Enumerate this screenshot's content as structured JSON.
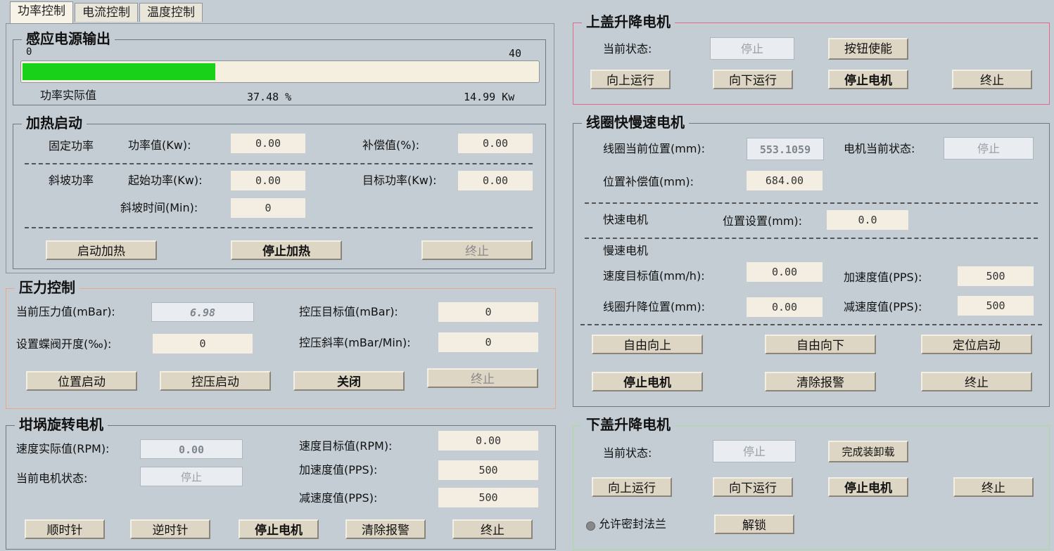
{
  "tabs": [
    "功率控制",
    "电流控制",
    "温度控制"
  ],
  "power_output": {
    "title": "感应电源输出",
    "scale_min": "0",
    "scale_max": "40",
    "progress_fraction": 0.3748,
    "actual_label": "功率实际值",
    "percent_text": "37.48 %",
    "kw_text": "14.99 Kw"
  },
  "heating": {
    "title": "加热启动",
    "fixed_power": "固定功率",
    "power_value_label": "功率值(Kw):",
    "power_value": "0.00",
    "compensation_label": "补偿值(%):",
    "compensation_value": "0.00",
    "ramp_power": "斜坡功率",
    "start_power_label": "起始功率(Kw):",
    "start_power_value": "0.00",
    "target_power_label": "目标功率(Kw):",
    "target_power_value": "0.00",
    "ramp_time_label": "斜坡时间(Min):",
    "ramp_time_value": "0",
    "start_btn": "启动加热",
    "stop_btn": "停止加热",
    "abort_btn": "终止"
  },
  "pressure": {
    "title": "压力控制",
    "current_label": "当前压力值(mBar):",
    "current_value": "6.98",
    "target_label": "控压目标值(mBar):",
    "target_value": "0",
    "valve_label": "设置蝶阀开度(‰):",
    "valve_value": "0",
    "slope_label": "控压斜率(mBar/Min):",
    "slope_value": "0",
    "pos_start_btn": "位置启动",
    "pressure_start_btn": "控压启动",
    "close_btn": "关闭",
    "abort_btn": "终止"
  },
  "crucible": {
    "title": "坩埚旋转电机",
    "speed_actual_label": "速度实际值(RPM):",
    "speed_actual_value": "0.00",
    "status_label": "当前电机状态:",
    "status_value": "停止",
    "speed_target_label": "速度目标值(RPM):",
    "speed_target_value": "0.00",
    "accel_label": "加速度值(PPS):",
    "accel_value": "500",
    "decel_label": "减速度值(PPS):",
    "decel_value": "500",
    "cw_btn": "顺时针",
    "ccw_btn": "逆时针",
    "stop_btn": "停止电机",
    "clear_btn": "清除报警",
    "abort_btn": "终止"
  },
  "upper_lid": {
    "title": "上盖升降电机",
    "status_label": "当前状态:",
    "status_value": "停止",
    "enable_btn": "按钮使能",
    "up_btn": "向上运行",
    "down_btn": "向下运行",
    "stop_btn": "停止电机",
    "abort_btn": "终止"
  },
  "coil": {
    "title": "线圈快慢速电机",
    "pos_label": "线圈当前位置(mm):",
    "pos_value": "553.1059",
    "motor_status_label": "电机当前状态:",
    "motor_status_value": "停止",
    "comp_label": "位置补偿值(mm):",
    "comp_value": "684.00",
    "fast_label": "快速电机",
    "pos_set_label": "位置设置(mm):",
    "pos_set_value": "0.0",
    "slow_label": "慢速电机",
    "speed_target_label": "速度目标值(mm/h):",
    "speed_target_value": "0.00",
    "accel_label": "加速度值(PPS):",
    "accel_value": "500",
    "lift_pos_label": "线圈升降位置(mm):",
    "lift_pos_value": "0.00",
    "decel_label": "减速度值(PPS):",
    "decel_value": "500",
    "free_up_btn": "自由向上",
    "free_down_btn": "自由向下",
    "pos_start_btn": "定位启动",
    "stop_btn": "停止电机",
    "clear_btn": "清除报警",
    "abort_btn": "终止"
  },
  "lower_lid": {
    "title": "下盖升降电机",
    "status_label": "当前状态:",
    "status_value": "停止",
    "finish_btn": "完成装卸载",
    "up_btn": "向上运行",
    "down_btn": "向下运行",
    "stop_btn": "停止电机",
    "abort_btn": "终止",
    "allow_seal_label": "允许密封法兰",
    "unlock_btn": "解锁"
  },
  "colors": {
    "progress_fill": "#19d119",
    "pressure_border": "#e8a88a",
    "upper_lid_border": "#e06a8a",
    "lower_lid_border": "#a9dc9a"
  }
}
